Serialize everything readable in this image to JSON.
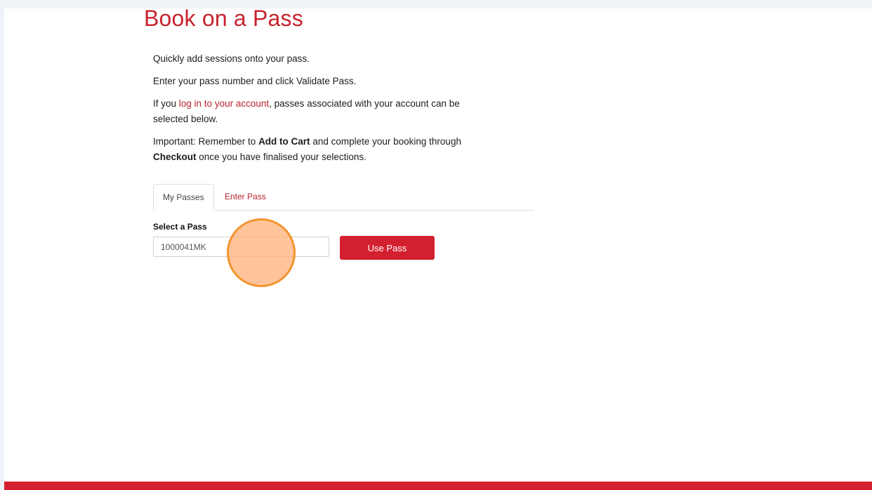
{
  "page": {
    "title": "Book on a Pass"
  },
  "intro": {
    "line1": "Quickly add sessions onto your pass.",
    "line2": "Enter your pass number and click Validate Pass.",
    "line3_prefix": "If you ",
    "line3_link": "log in to your account",
    "line3_suffix": ", passes associated with your account can be selected below.",
    "line4_prefix": "Important: Remember to ",
    "line4_bold1": "Add to Cart",
    "line4_middle": " and complete your booking through ",
    "line4_bold2": "Checkout",
    "line4_suffix": " once you have finalised your selections."
  },
  "tabs": [
    {
      "label": "My Passes",
      "active": true
    },
    {
      "label": "Enter Pass",
      "active": false
    }
  ],
  "form": {
    "select_label": "Select a Pass",
    "pass_value": "1000041MK",
    "submit_label": "Use Pass"
  },
  "colors": {
    "brand_red": "#d3202f",
    "link_red": "#b8232e",
    "click_marker": "#f3942d"
  }
}
